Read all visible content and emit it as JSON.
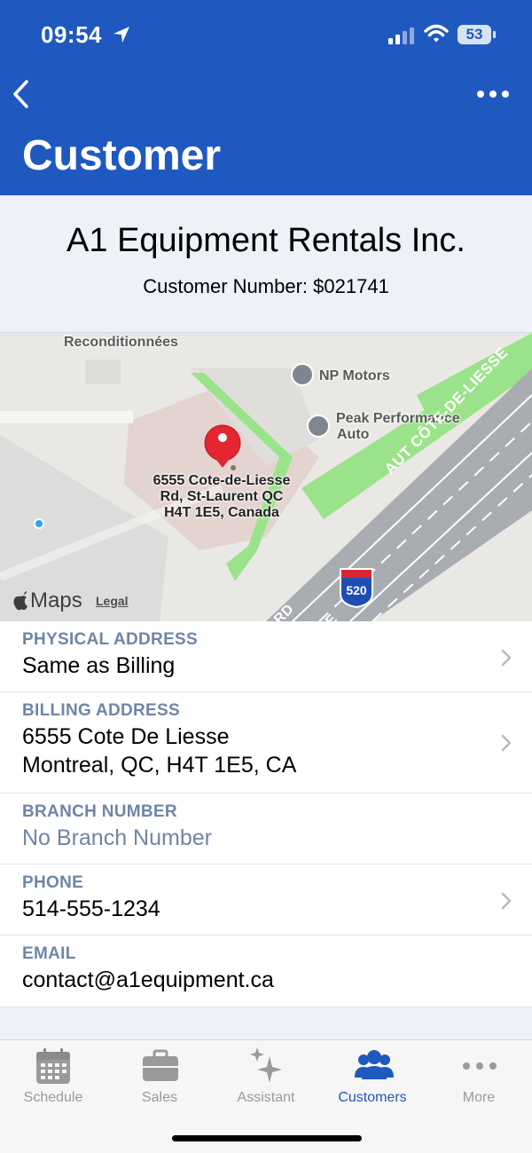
{
  "status_bar": {
    "time": "09:54",
    "battery": "53"
  },
  "header": {
    "title": "Customer"
  },
  "customer": {
    "name": "A1 Equipment Rentals Inc.",
    "number_line": "Customer Number: $021741"
  },
  "map": {
    "labels": {
      "reconditionnees": "Reconditionnées",
      "np_motors": "NP Motors",
      "peak_performance_1": "Peak Performance",
      "peak_performance_2": "Auto",
      "road": "AUT CÔTE-DE-LIESSE",
      "road_fragment_1": "RD",
      "road_fragment_2": "E"
    },
    "pin_address": [
      "6555 Cote-de-Liesse",
      "Rd, St-Laurent QC",
      "H4T 1E5, Canada"
    ],
    "highway_number": "520",
    "maps_brand": "Maps",
    "legal": "Legal"
  },
  "fields": {
    "physical": {
      "label": "PHYSICAL ADDRESS",
      "value": "Same as Billing"
    },
    "billing": {
      "label": "BILLING ADDRESS",
      "line1": "6555 Cote De Liesse",
      "line2": "Montreal, QC, H4T 1E5, CA"
    },
    "branch": {
      "label": "BRANCH NUMBER",
      "value": "No Branch Number"
    },
    "phone": {
      "label": "PHONE",
      "value": "514-555-1234"
    },
    "email": {
      "label": "EMAIL",
      "value": "contact@a1equipment.ca"
    }
  },
  "tabs": [
    {
      "label": "Schedule",
      "icon": "calendar-icon"
    },
    {
      "label": "Sales",
      "icon": "briefcase-icon"
    },
    {
      "label": "Assistant",
      "icon": "sparkles-icon"
    },
    {
      "label": "Customers",
      "icon": "people-icon",
      "active": true
    },
    {
      "label": "More",
      "icon": "ellipsis-icon"
    }
  ],
  "colors": {
    "brand_blue": "#1f59c0",
    "label_slate": "#6e86a6",
    "map_green": "#9be38a"
  }
}
